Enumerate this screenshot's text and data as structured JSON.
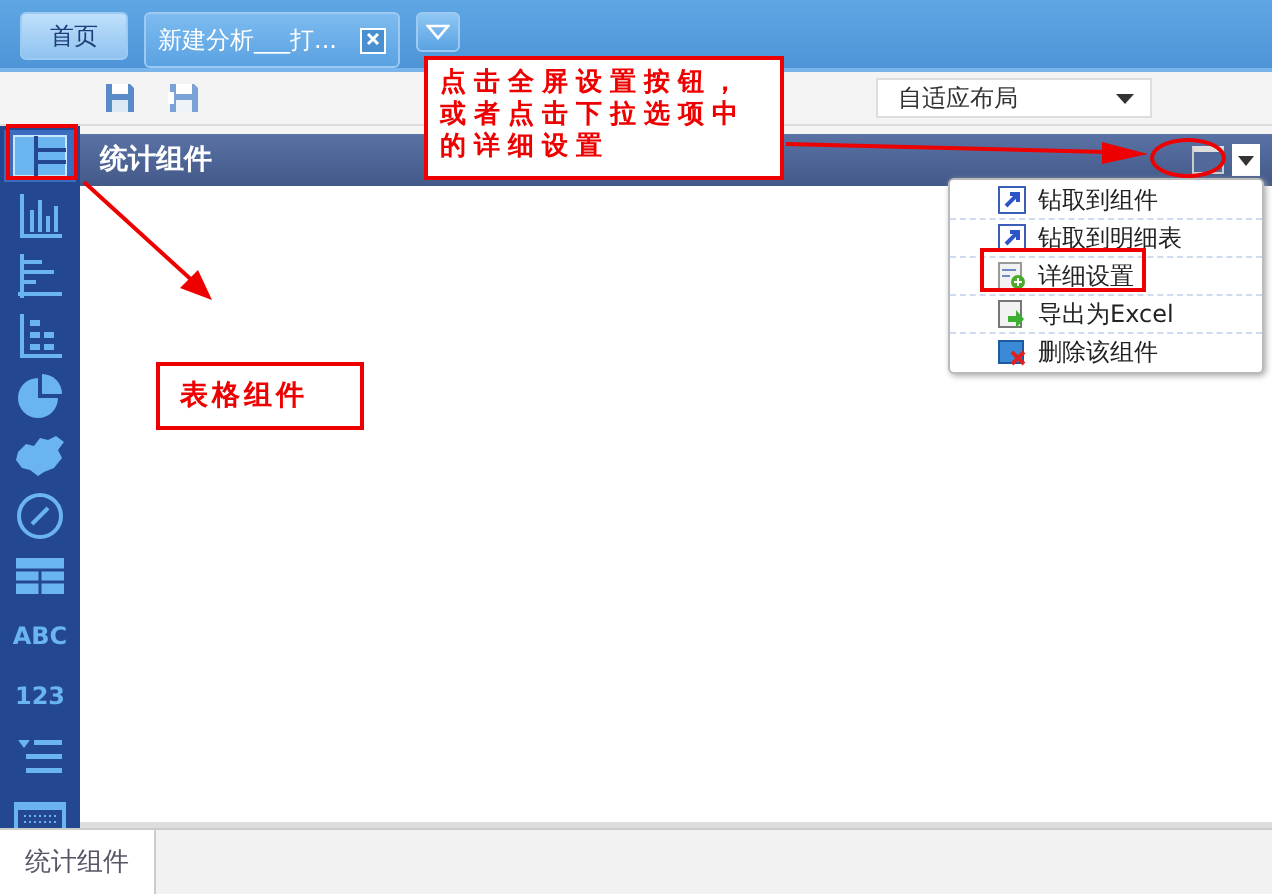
{
  "tabs": [
    {
      "label": "首页",
      "selected": false,
      "closable": false
    },
    {
      "label": "新建分析___打...",
      "selected": true,
      "closable": true
    }
  ],
  "layout_select": {
    "value": "自适应布局"
  },
  "sidebar": {
    "items": [
      {
        "kind": "icon",
        "selected": true
      },
      {
        "kind": "icon",
        "selected": false
      },
      {
        "kind": "icon",
        "selected": false
      },
      {
        "kind": "icon",
        "selected": false
      },
      {
        "kind": "icon",
        "selected": false
      },
      {
        "kind": "icon",
        "selected": false
      },
      {
        "kind": "icon",
        "selected": false
      },
      {
        "kind": "icon",
        "selected": false
      },
      {
        "kind": "text",
        "label": "ABC",
        "selected": false
      },
      {
        "kind": "text",
        "label": "123",
        "selected": false
      },
      {
        "kind": "icon",
        "selected": false
      },
      {
        "kind": "icon",
        "selected": false
      }
    ]
  },
  "panel": {
    "title": "统计组件"
  },
  "menu": {
    "items": [
      {
        "label": "钻取到组件"
      },
      {
        "label": "钻取到明细表"
      },
      {
        "label": "详细设置"
      },
      {
        "label": "导出为Excel"
      },
      {
        "label": "删除该组件"
      }
    ]
  },
  "annotations": [
    {
      "text": "点击全屏设置按钮，或者点击下拉选项中的详细设置"
    },
    {
      "text": "表格组件"
    }
  ],
  "bottom_tabs": [
    {
      "label": "统计组件",
      "selected": true
    }
  ]
}
